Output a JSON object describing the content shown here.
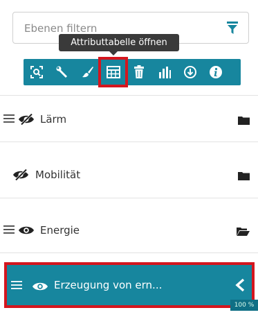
{
  "filter": {
    "placeholder": "Ebenen filtern",
    "icon": "funnel-icon"
  },
  "tooltip": {
    "text": "Attributtabelle öffnen"
  },
  "toolbar": {
    "tools": [
      {
        "name": "zoom-extent-icon",
        "active": false
      },
      {
        "name": "wrench-icon",
        "active": false
      },
      {
        "name": "brush-icon",
        "active": false
      },
      {
        "name": "table-icon",
        "active": true
      },
      {
        "name": "trash-icon",
        "active": false
      },
      {
        "name": "bar-chart-icon",
        "active": false
      },
      {
        "name": "download-icon",
        "active": false
      },
      {
        "name": "info-icon",
        "active": false
      }
    ]
  },
  "layers": [
    {
      "label": "Lärm",
      "visible": false,
      "folder": "closed"
    },
    {
      "label": "Mobilität",
      "visible": false,
      "folder": "closed"
    },
    {
      "label": "Energie",
      "visible": true,
      "folder": "open"
    }
  ],
  "active_layer": {
    "label": "Erzeugung von ern...",
    "visible": true
  },
  "zoom_badge": "100 %",
  "colors": {
    "accent": "#17869e",
    "highlight": "#d4161e",
    "tooltip_bg": "#3a3a3a"
  }
}
